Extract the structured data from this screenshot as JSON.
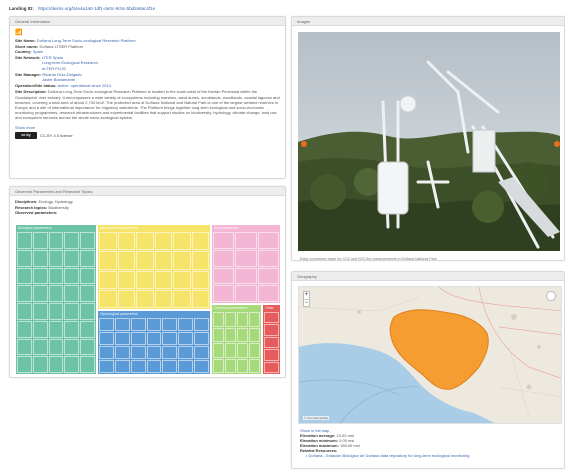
{
  "permalink": {
    "label": "Landing ID:",
    "url": "https://deims.org/b4e4a1a0-1df1-4e0c-9c5c-5bd2e8ac4f1e"
  },
  "general": {
    "header": "General Information",
    "icon": "rss-feed-icon",
    "site_name_label": "Site Name:",
    "site_name": "Doñana Long-Term Socio-ecological Research Platform",
    "short_name_label": "Short name:",
    "short_name": "Doñana LTSER Platform",
    "country_label": "Country:",
    "country": "Spain",
    "network_label": "Site Network:",
    "networks": [
      "LTER Spain",
      "Long-term Ecological Research",
      "eLTER PLUS"
    ],
    "manager_label": "Site Manager:",
    "managers": [
      "Ricardo Díaz-Delgado",
      "Javier Bustamante"
    ],
    "operation_label": "Operation/Site status:",
    "operation": "Active, operational since 2014",
    "description_label": "Site Description:",
    "description": "Doñana Long-Term Socio-ecological Research Platform is located in the south-west of the Iberian Peninsula within the Guadalquivir river estuary. It encompasses a wide variety of ecosystems including marshes, sand dunes, scrublands, woodlands, coastal lagoons and beaches, covering a total area of about 2,700 km2. The protected area of Doñana National and Natural Park is one of the largest wetland reserves in Europe and a site of international importance for migratory waterbirds. The Platform brings together long-term ecological and socio-economic monitoring programmes, research infrastructures and experimental facilities that support studies on biodiversity, hydrology, climate change, land use and ecosystem services across the whole socio-ecological system.",
    "show_more": "Show more",
    "license_badge": "cc by",
    "license_text": "CC-BY 4.0 license"
  },
  "variables": {
    "header": "Observed Parameters and Research Topics",
    "discipline_label": "Disciplines:",
    "disciplines": "Ecology, Hydrology",
    "topics_label": "Research topics:",
    "topics": "Biodiversity",
    "parameters_label": "Observed parameters:",
    "groups": [
      {
        "title": "Biological parameters",
        "color": "#6cc4a4",
        "cols": 5,
        "cells": 40
      },
      {
        "title": "Atmospheric parameters",
        "color": "#f5e36a",
        "cols": 6,
        "cells": 24
      },
      {
        "title": "Soil parameters",
        "color": "#f3b6d4",
        "cols": 3,
        "cells": 12
      },
      {
        "title": "Hydrological parameters",
        "color": "#5b9bd5",
        "cols": 7,
        "cells": 28
      },
      {
        "title": "Chemical parameters",
        "color": "#a6d87c",
        "cols": 4,
        "cells": 16
      },
      {
        "title": "Other",
        "color": "#e65c5c",
        "cols": 1,
        "cells": 5
      }
    ]
  },
  "images": {
    "header": "Images",
    "caption": "Eddy covariance tower for CO2 and H2O flux measurements in Doñana National Park"
  },
  "geography": {
    "header": "Geography",
    "zoom_in": "+",
    "zoom_out": "−",
    "attribution": "© OpenStreetMap",
    "show_map": "Show in full map",
    "elevation_avg_label": "Elevation average:",
    "elevation_avg": "10.00 msl",
    "elevation_min_label": "Elevation minimum:",
    "elevation_min": "0.00 msl",
    "elevation_max_label": "Elevation maximum:",
    "elevation_max": "156.00 msl",
    "related_label": "Related Resources:",
    "related": "Doñana - Estación Biológica de Doñana data repository for long-term ecological monitoring"
  },
  "colors": {
    "link": "#3a66b0",
    "sea": "#a9cce7",
    "site": "#f59d30",
    "land": "#eee9df"
  }
}
